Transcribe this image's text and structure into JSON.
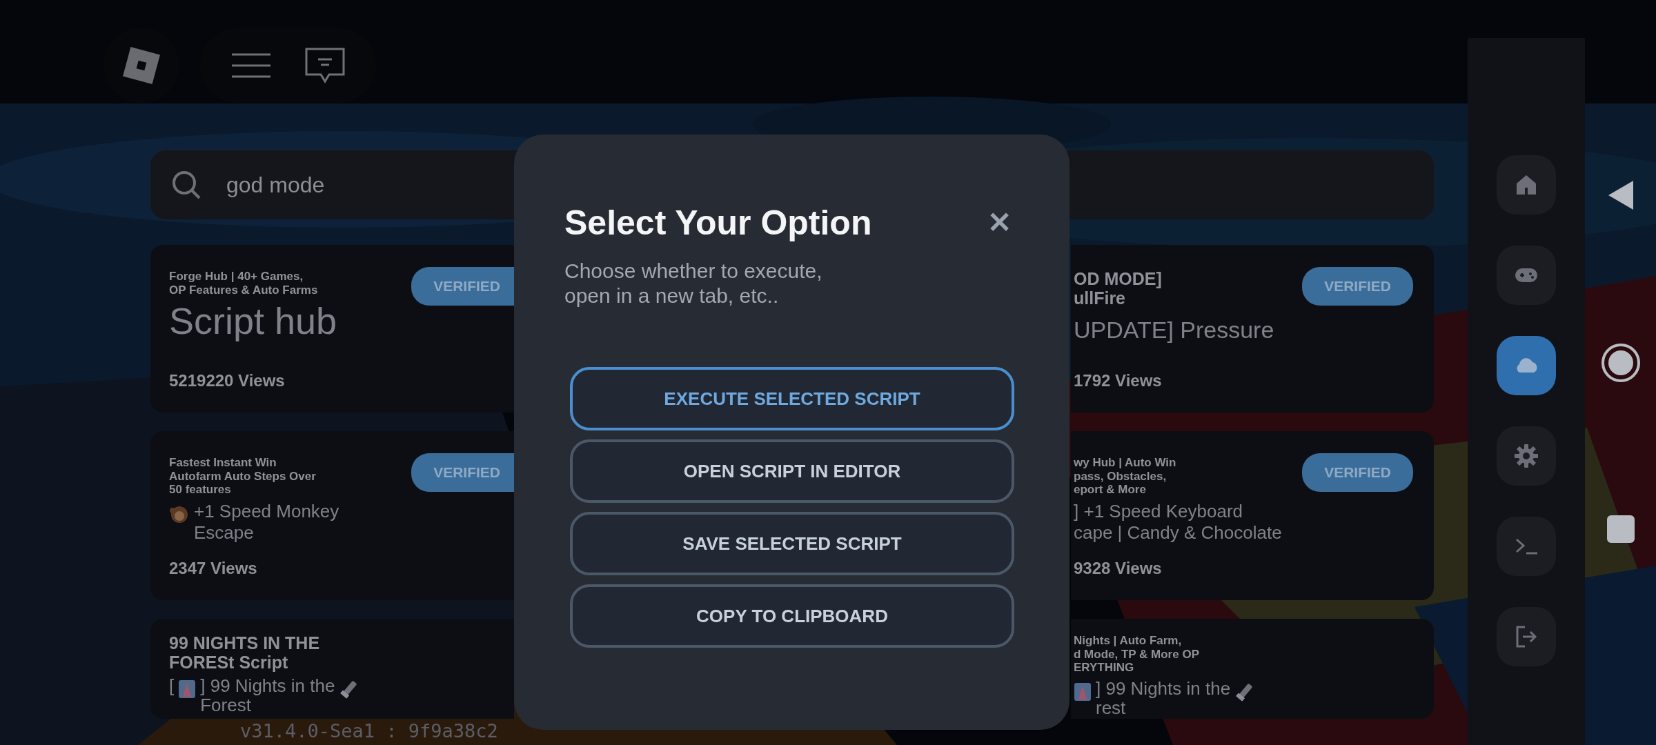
{
  "top_bar": {
    "search": {
      "value": "god mode"
    }
  },
  "cards": [
    {
      "kind": "hub",
      "heading": "Forge Hub | 40+ Games,\nOP Features & Auto Farms",
      "title": [
        {
          "kind": "text",
          "text": "Script hub"
        }
      ],
      "views": "5219220 Views",
      "badge": "VERIFIED"
    },
    {
      "kind": "headline",
      "heading": "OD MODE]\nullFire",
      "title": [
        {
          "kind": "text",
          "text": "UPDATE] Pressure"
        }
      ],
      "views": "1792 Views",
      "badge": "VERIFIED"
    },
    {
      "kind": "plain",
      "heading": "Fastest Instant Win\nAutofarm Auto Steps Over\n50 features",
      "title": [
        {
          "kind": "monkey"
        },
        {
          "kind": "text",
          "text": "+1 Speed Monkey\nEscape"
        }
      ],
      "views": "2347 Views",
      "badge": "VERIFIED"
    },
    {
      "kind": "plain",
      "heading": "wy Hub | Auto Win\npass, Obstacles,\neport & More",
      "title": [
        {
          "kind": "text",
          "text": "] +1 Speed Keyboard\ncape | Candy & Chocolate"
        }
      ],
      "views": "9328 Views",
      "badge": "VERIFIED"
    },
    {
      "kind": "titled",
      "heading": "99 NIGHTS IN THE\nFORESt Script",
      "title": [
        {
          "kind": "text",
          "text": "["
        },
        {
          "kind": "tile"
        },
        {
          "kind": "text",
          "text": "] 99 Nights in the\nForest"
        },
        {
          "kind": "torch"
        }
      ]
    },
    {
      "kind": "plain",
      "heading": "Nights | Auto Farm,\nd Mode, TP & More OP\nERYTHING",
      "title": [
        {
          "kind": "tile"
        },
        {
          "kind": "text",
          "text": "] 99 Nights in the\nrest"
        },
        {
          "kind": "torch"
        }
      ]
    }
  ],
  "version": "v31.4.0-Sea1 : 9f9a38c2",
  "modal": {
    "title": "Select Your Option",
    "close": "✕",
    "subtitle": "Choose whether to execute,\nopen in a new tab, etc..",
    "options": [
      {
        "label": "EXECUTE SELECTED SCRIPT",
        "selected": true
      },
      {
        "label": "OPEN SCRIPT IN EDITOR",
        "selected": false
      },
      {
        "label": "SAVE SELECTED SCRIPT",
        "selected": false
      },
      {
        "label": "COPY TO CLIPBOARD",
        "selected": false
      }
    ]
  },
  "sidebar": {
    "items": [
      {
        "kind": "home",
        "selected": false
      },
      {
        "kind": "gamepad",
        "selected": false
      },
      {
        "kind": "cloud",
        "selected": true
      },
      {
        "kind": "settings",
        "selected": false
      },
      {
        "kind": "terminal",
        "selected": false
      },
      {
        "kind": "exit",
        "selected": false
      }
    ]
  }
}
